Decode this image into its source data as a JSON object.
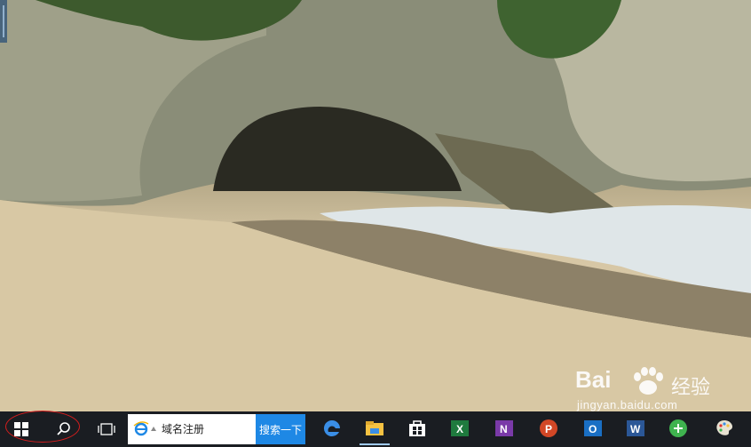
{
  "desktop": {
    "wallpaper": "beach-cave-wallpaper"
  },
  "taskbar": {
    "start_icon": "windows-start-icon",
    "search_icon": "search-icon",
    "task_view_icon": "task-view-icon",
    "browser_search": {
      "icon": "ie-icon",
      "value": "域名注册",
      "button_label": "搜索一下"
    },
    "apps": [
      {
        "name": "edge",
        "icon": "edge-icon"
      },
      {
        "name": "file-explorer",
        "icon": "folder-icon"
      },
      {
        "name": "store",
        "icon": "store-icon"
      },
      {
        "name": "excel",
        "icon": "excel-icon",
        "letter": "X"
      },
      {
        "name": "onenote",
        "icon": "onenote-icon",
        "letter": "N"
      },
      {
        "name": "powerpoint",
        "icon": "powerpoint-icon",
        "letter": "P"
      },
      {
        "name": "outlook",
        "icon": "outlook-icon",
        "letter": "O"
      },
      {
        "name": "word",
        "icon": "word-icon",
        "letter": "W"
      },
      {
        "name": "green-app",
        "icon": "green-circle-icon"
      },
      {
        "name": "paint",
        "icon": "paint-palette-icon"
      }
    ]
  },
  "watermark": {
    "brand": "Bai",
    "brand_suffix": "经验",
    "domain": "jingyan.baidu.com"
  },
  "colors": {
    "taskbar_bg": "#1a1d22",
    "search_button": "#1e88e5",
    "highlight": "#d51d1d"
  }
}
